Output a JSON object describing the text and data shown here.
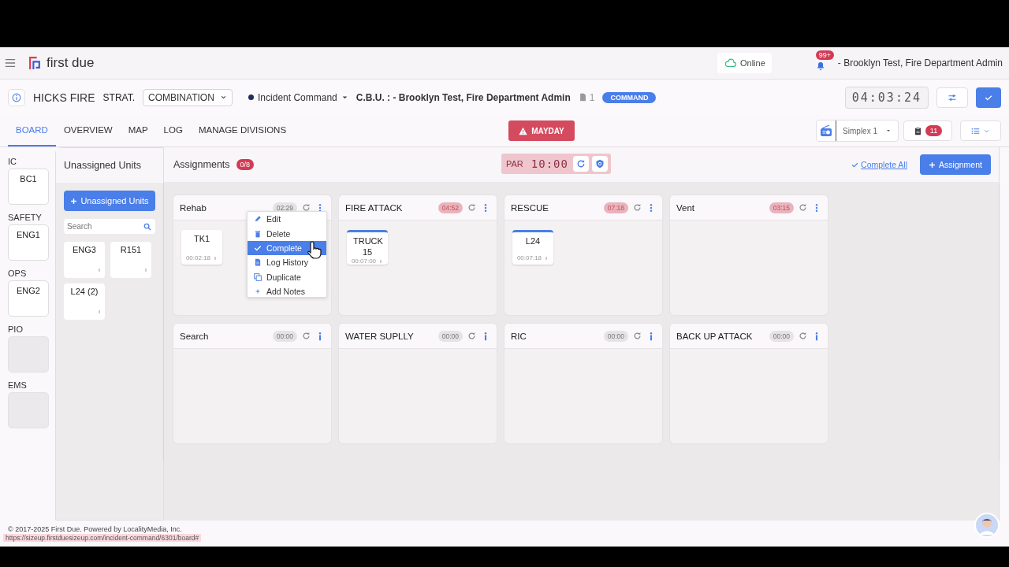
{
  "topbar": {
    "logo": "first due",
    "status": "Online",
    "notifications": "99+",
    "user": "- Brooklyn Test, Fire Department Admin"
  },
  "incident": {
    "name": "HICKS FIRE",
    "strategy_label": "STRAT.",
    "strategy": "COMBINATION",
    "role": "Incident Command",
    "cbu": "C.B.U. : - Brooklyn Test, Fire Department Admin",
    "documents": "1",
    "badge": "COMMAND",
    "clock": "04:03:24"
  },
  "tabs": [
    {
      "label": "BOARD",
      "selected": true
    },
    {
      "label": "OVERVIEW",
      "selected": false
    },
    {
      "label": "MAP",
      "selected": false
    },
    {
      "label": "LOG",
      "selected": false
    },
    {
      "label": "MANAGE DIVISIONS",
      "selected": false
    }
  ],
  "mayday": "MAYDAY",
  "channel": "Simplex 1",
  "tasks_count": "11",
  "roles": [
    {
      "label": "IC",
      "unit": "BC1"
    },
    {
      "label": "SAFETY",
      "unit": "ENG1"
    },
    {
      "label": "OPS",
      "unit": "ENG2"
    },
    {
      "label": "PIO"
    },
    {
      "label": "EMS"
    }
  ],
  "unassigned": {
    "title": "Unassigned Units",
    "button": "Unassigned Units",
    "search_placeholder": "Search",
    "units": [
      "ENG3",
      "R151",
      "L24 (2)"
    ]
  },
  "assignments": {
    "title": "Assignments",
    "count": "0/8",
    "par_label": "PAR",
    "par_timer": "10:00",
    "complete_all": "Complete All",
    "add_button": "Assignment",
    "groups": [
      {
        "name": "Rehab",
        "timer": "02:29",
        "alert": false,
        "kind": "menu",
        "units": [
          {
            "name": "TK1",
            "time": "00:02:18",
            "active": false
          }
        ]
      },
      {
        "name": "FIRE ATTACK",
        "timer": "04:52",
        "alert": true,
        "kind": "menu",
        "units": [
          {
            "name": "TRUCK 15",
            "time": "00:07:00",
            "active": true
          }
        ]
      },
      {
        "name": "RESCUE",
        "timer": "07:18",
        "alert": true,
        "kind": "menu",
        "units": [
          {
            "name": "L24",
            "time": "00:07:18",
            "active": true
          }
        ]
      },
      {
        "name": "Vent",
        "timer": "03:15",
        "alert": true,
        "kind": "menu"
      },
      {
        "name": "Search",
        "timer": "00:00",
        "alert": false,
        "kind": "info"
      },
      {
        "name": "WATER SUPLLY",
        "timer": "00:00",
        "alert": false,
        "kind": "info"
      },
      {
        "name": "RIC",
        "timer": "00:00",
        "alert": false,
        "kind": "info"
      },
      {
        "name": "BACK UP ATTACK",
        "timer": "00:00",
        "alert": false,
        "kind": "info"
      }
    ]
  },
  "context_menu": [
    {
      "label": "Edit",
      "kind": "edit",
      "selected": false
    },
    {
      "label": "Delete",
      "kind": "delete",
      "selected": false
    },
    {
      "label": "Complete",
      "kind": "complete",
      "selected": true
    },
    {
      "label": "Log History",
      "kind": "log",
      "selected": false
    },
    {
      "label": "Duplicate",
      "kind": "duplicate",
      "selected": false
    },
    {
      "label": "Add Notes",
      "kind": "add",
      "selected": false
    }
  ],
  "footer": "© 2017-2025 First Due. Powered by LocalityMedia, Inc.",
  "status_url": "https://sizeup.firstduesizeup.com/incident-command/6301/board#"
}
